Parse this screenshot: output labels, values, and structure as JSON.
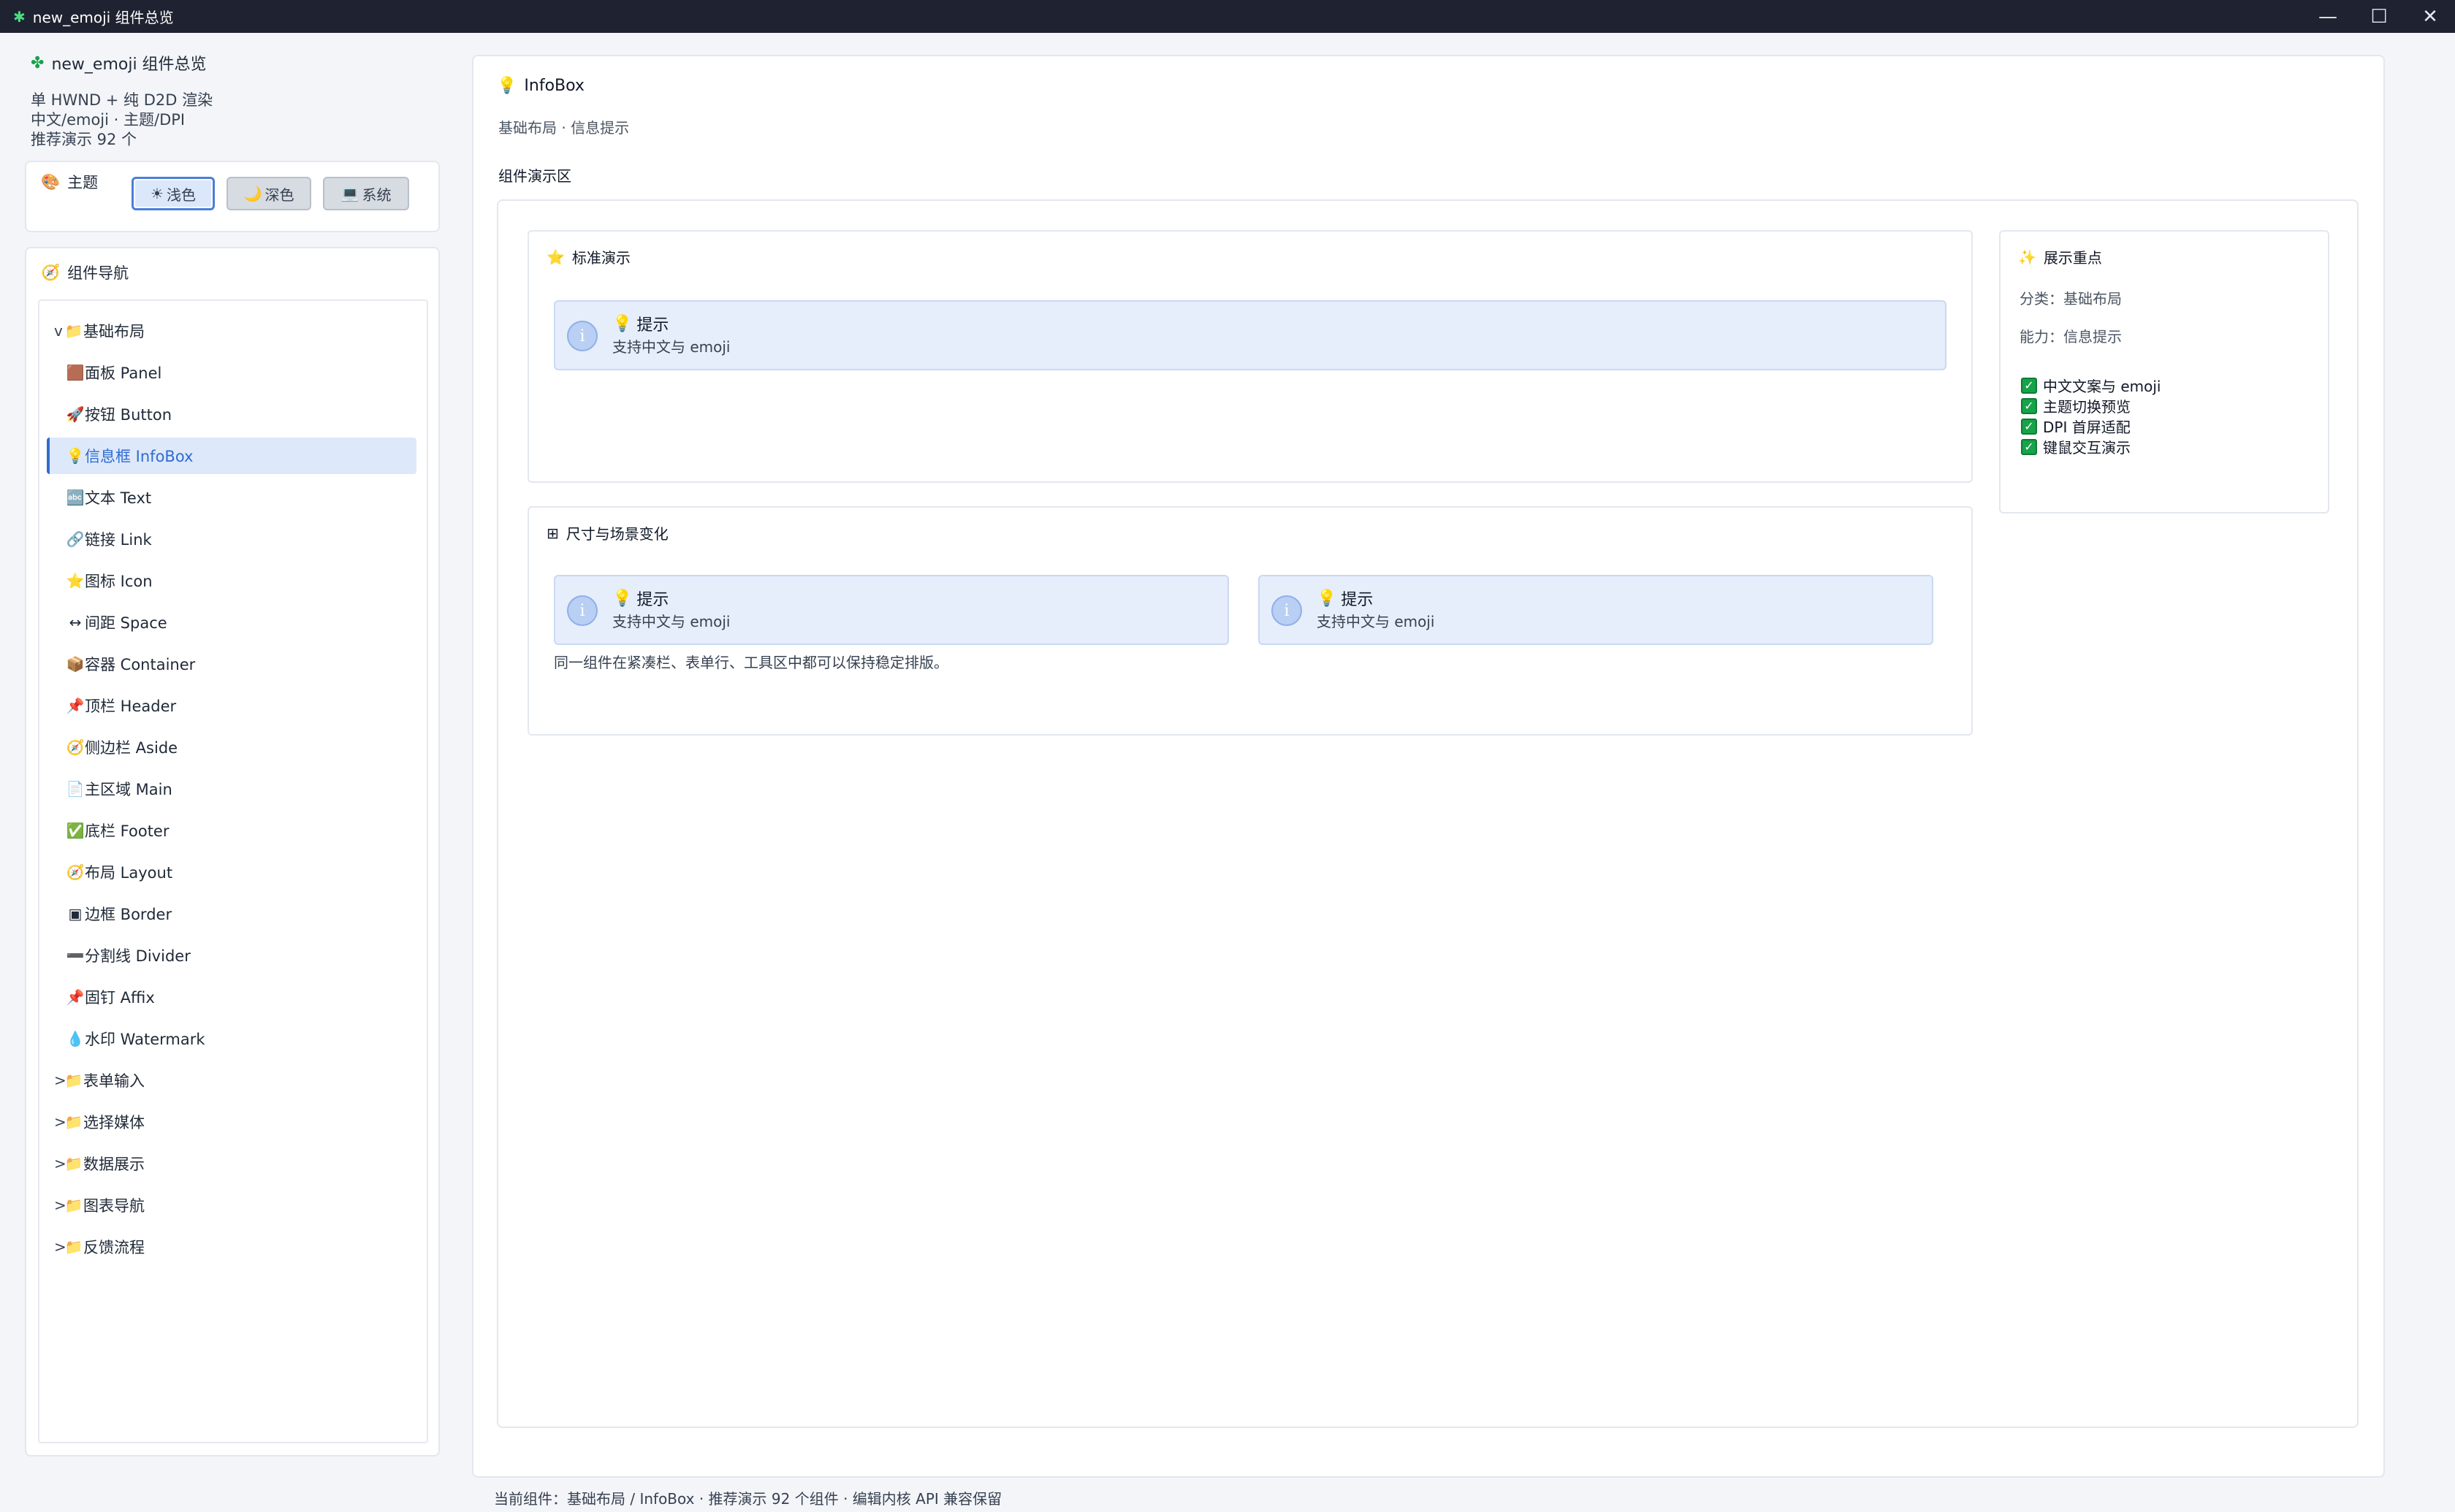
{
  "window": {
    "title": "new_emoji 组件总览",
    "controls": {
      "minimize": "—",
      "maximize": "☐",
      "close": "✕"
    }
  },
  "sidebar": {
    "app_title": "new_emoji 组件总览",
    "subtitle_lines": [
      "单 HWND + 纯 D2D 渲染",
      "中文/emoji · 主题/DPI",
      "推荐演示 92 个"
    ],
    "theme": {
      "label": "主题",
      "buttons": [
        {
          "label": "浅色",
          "icon": "☀"
        },
        {
          "label": "深色",
          "icon": "🌙"
        },
        {
          "label": "系统",
          "icon": "💻"
        }
      ],
      "active": "浅色"
    },
    "nav": {
      "label": "组件导航",
      "items": [
        {
          "toggle": "v",
          "icon": "📁",
          "label": "基础布局",
          "type": "group"
        },
        {
          "icon": "🟫",
          "label": "面板 Panel",
          "type": "child"
        },
        {
          "icon": "🚀",
          "label": "按钮 Button",
          "type": "child"
        },
        {
          "icon": "💡",
          "label": "信息框 InfoBox",
          "type": "child",
          "selected": true
        },
        {
          "icon": "🔤",
          "label": "文本 Text",
          "type": "child"
        },
        {
          "icon": "🔗",
          "label": "链接 Link",
          "type": "child"
        },
        {
          "icon": "⭐",
          "label": "图标 Icon",
          "type": "child"
        },
        {
          "icon": "↔",
          "label": "间距 Space",
          "type": "child"
        },
        {
          "icon": "📦",
          "label": "容器 Container",
          "type": "child"
        },
        {
          "icon": "📌",
          "label": "顶栏 Header",
          "type": "child"
        },
        {
          "icon": "🧭",
          "label": "侧边栏 Aside",
          "type": "child"
        },
        {
          "icon": "📄",
          "label": "主区域 Main",
          "type": "child"
        },
        {
          "icon": "✅",
          "label": "底栏 Footer",
          "type": "child"
        },
        {
          "icon": "🧭",
          "label": "布局 Layout",
          "type": "child"
        },
        {
          "icon": "▣",
          "label": "边框 Border",
          "type": "child"
        },
        {
          "icon": "➖",
          "label": "分割线 Divider",
          "type": "child"
        },
        {
          "icon": "📌",
          "label": "固钉 Affix",
          "type": "child"
        },
        {
          "icon": "💧",
          "label": "水印 Watermark",
          "type": "child"
        },
        {
          "toggle": ">",
          "icon": "📁",
          "label": "表单输入",
          "type": "group"
        },
        {
          "toggle": ">",
          "icon": "📁",
          "label": "选择媒体",
          "type": "group"
        },
        {
          "toggle": ">",
          "icon": "📁",
          "label": "数据展示",
          "type": "group"
        },
        {
          "toggle": ">",
          "icon": "📁",
          "label": "图表导航",
          "type": "group"
        },
        {
          "toggle": ">",
          "icon": "📁",
          "label": "反馈流程",
          "type": "group"
        }
      ]
    }
  },
  "main": {
    "title": "InfoBox",
    "subtitle": "基础布局 · 信息提示",
    "demo_label": "组件演示区",
    "standard": {
      "title": "标准演示",
      "info": {
        "icon_text": "i",
        "title": "提示",
        "desc": "支持中文与 emoji"
      }
    },
    "sizes": {
      "title": "尺寸与场景变化",
      "infos": [
        {
          "icon_text": "i",
          "title": "提示",
          "desc": "支持中文与 emoji"
        },
        {
          "icon_text": "i",
          "title": "提示",
          "desc": "支持中文与 emoji"
        }
      ],
      "note": "同一组件在紧凑栏、表单行、工具区中都可以保持稳定排版。"
    },
    "focus": {
      "title": "展示重点",
      "category": "分类：基础布局",
      "ability": "能力：信息提示",
      "checks": [
        "中文文案与 emoji",
        "主题切换预览",
        "DPI 首屏适配",
        "键鼠交互演示"
      ]
    }
  },
  "footer": {
    "text": "当前组件：基础布局 / InfoBox · 推荐演示 92 个组件 · 编辑内核 API 兼容保留"
  }
}
